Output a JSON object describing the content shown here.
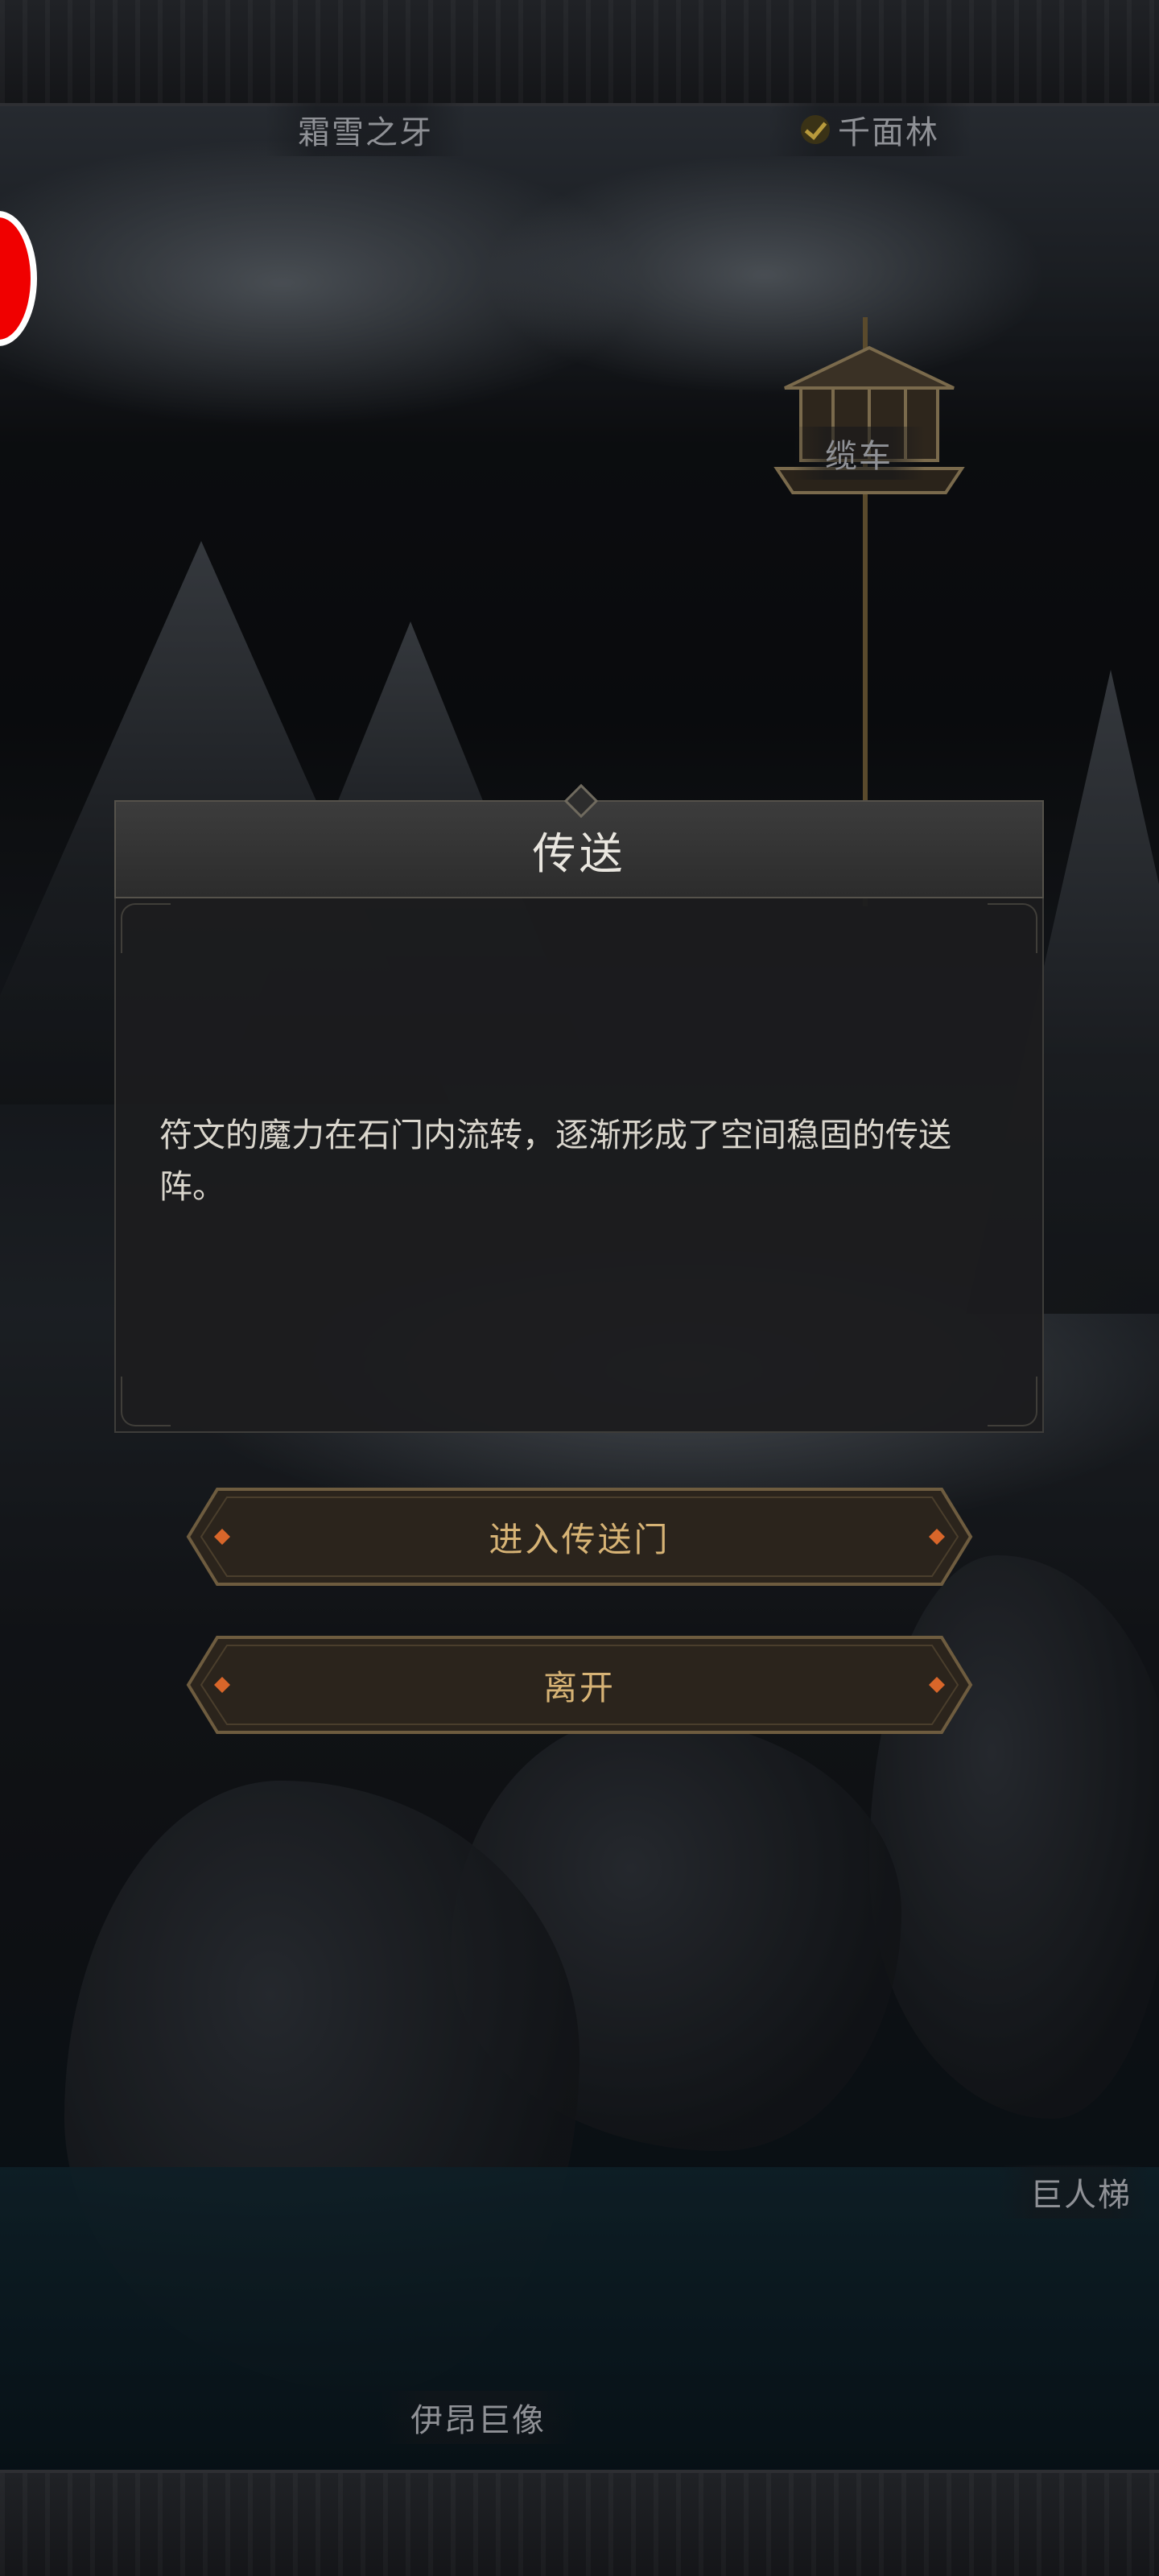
{
  "map": {
    "labels": {
      "frost_fang": "霜雪之牙",
      "thousand_faces_forest": "千面林",
      "cable_car": "缆车",
      "giant_ladder": "巨人梯",
      "iang_statue": "伊昂巨像"
    },
    "completed_icon": "check-icon"
  },
  "dialog": {
    "title": "传送",
    "message": "符文的魔力在石门内流转，逐渐形成了空间稳固的传送阵。"
  },
  "actions": {
    "enter_portal": "进入传送门",
    "leave": "离开"
  },
  "colors": {
    "accent_gold": "#d7b375",
    "record_red": "#f00000"
  }
}
